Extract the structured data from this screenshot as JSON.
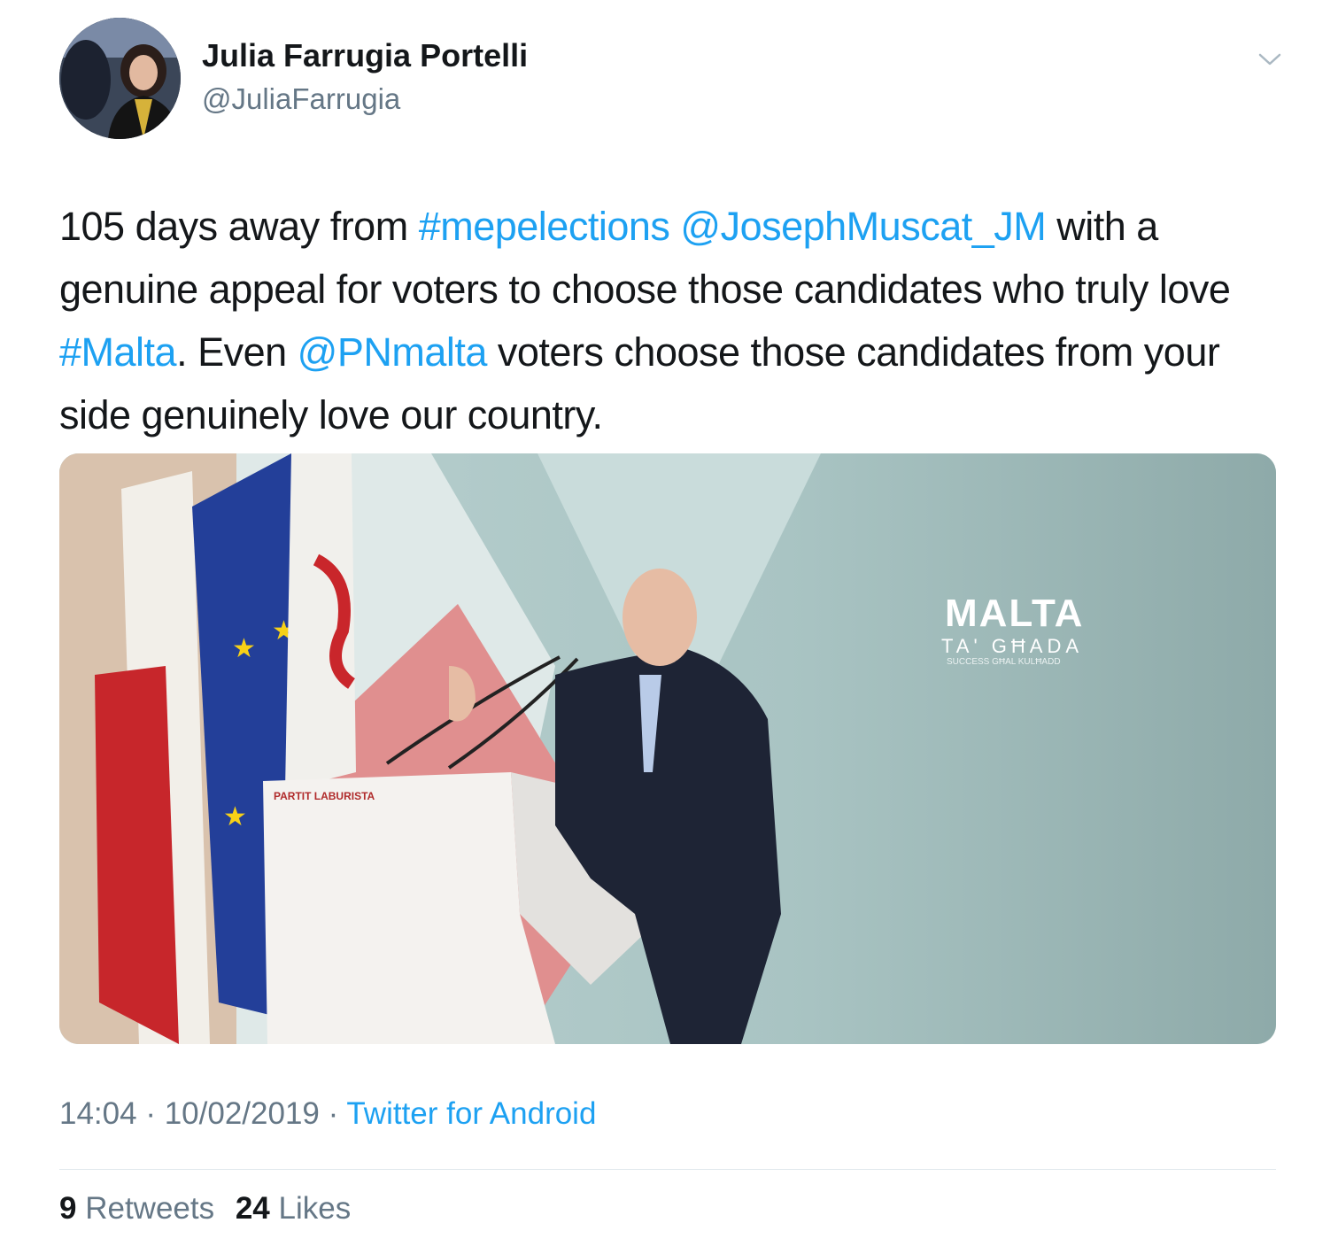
{
  "author": {
    "name": "Julia Farrugia Portelli",
    "handle": "@JuliaFarrugia"
  },
  "tweet": {
    "parts": [
      {
        "text": "105 days away from ",
        "link": false
      },
      {
        "text": "#mepelections",
        "link": true
      },
      {
        "text": " ",
        "link": false
      },
      {
        "text": "@JosephMuscat_JM",
        "link": true
      },
      {
        "text": " with a genuine appeal for voters to choose those candidates who truly love ",
        "link": false
      },
      {
        "text": "#Malta",
        "link": true
      },
      {
        "text": ". Even ",
        "link": false
      },
      {
        "text": "@PNmalta",
        "link": true
      },
      {
        "text": " voters choose those candidates from your side genuinely love our country.",
        "link": false
      }
    ]
  },
  "media": {
    "podium_text": "PARTIT LABURISTA",
    "logo_title": "MALTA",
    "logo_subtitle": "TA' GĦADA",
    "logo_tagline": "SUCCESS GĦAL KULĦADD"
  },
  "meta": {
    "time": "14:04",
    "separator": " · ",
    "date": "10/02/2019",
    "source": "Twitter for Android"
  },
  "stats": {
    "retweets_count": "9",
    "retweets_label": "Retweets",
    "likes_count": "24",
    "likes_label": "Likes"
  },
  "colors": {
    "link": "#1da1f2",
    "secondary_text": "#657786",
    "primary_text": "#14171a"
  },
  "icons": [
    "chevron-down-icon"
  ]
}
